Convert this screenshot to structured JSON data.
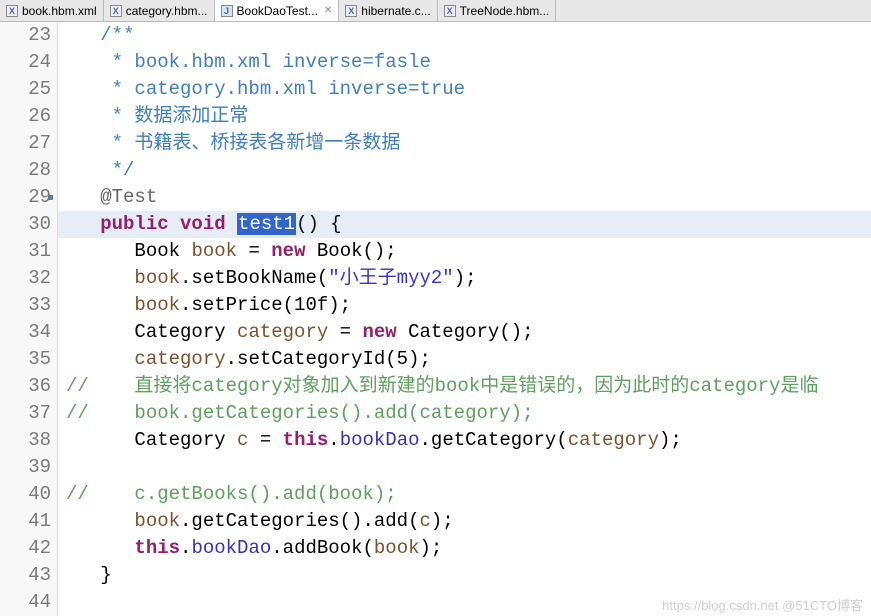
{
  "tabs": [
    {
      "label": "book.hbm.xml",
      "icon": "x",
      "active": false
    },
    {
      "label": "category.hbm...",
      "icon": "x",
      "active": false
    },
    {
      "label": "BookDaoTest...",
      "icon": "j",
      "active": true
    },
    {
      "label": "hibernate.c...",
      "icon": "x",
      "active": false
    },
    {
      "label": "TreeNode.hbm...",
      "icon": "x",
      "active": false
    }
  ],
  "lines": {
    "start": 23,
    "highlighted": 30,
    "marker_at": 29,
    "items": [
      {
        "n": 23,
        "kind": "doc",
        "text": "   /**"
      },
      {
        "n": 24,
        "kind": "doc",
        "text": "    * book.hbm.xml inverse=fasle"
      },
      {
        "n": 25,
        "kind": "doc",
        "text": "    * category.hbm.xml inverse=true"
      },
      {
        "n": 26,
        "kind": "doc",
        "text": "    * 数据添加正常"
      },
      {
        "n": 27,
        "kind": "doc",
        "text": "    * 书籍表、桥接表各新增一条数据"
      },
      {
        "n": 28,
        "kind": "doc",
        "text": "    */"
      },
      {
        "n": 29,
        "kind": "anno",
        "text": "   @Test"
      },
      {
        "n": 30,
        "kind": "sig",
        "pre": "   ",
        "kw": "public void ",
        "sel": "test1",
        "post": "() {"
      },
      {
        "n": 31,
        "kind": "stmt",
        "pre": "      ",
        "segs": [
          {
            "t": "Book ",
            "c": "c-type"
          },
          {
            "t": "book",
            "c": "c-var"
          },
          {
            "t": " = ",
            "c": ""
          },
          {
            "t": "new",
            "c": "c-kw"
          },
          {
            "t": " Book();",
            "c": ""
          }
        ]
      },
      {
        "n": 32,
        "kind": "stmt",
        "pre": "      ",
        "segs": [
          {
            "t": "book",
            "c": "c-var"
          },
          {
            "t": ".setBookName(",
            "c": ""
          },
          {
            "t": "\"小王子myy2\"",
            "c": "c-str"
          },
          {
            "t": ");",
            "c": ""
          }
        ]
      },
      {
        "n": 33,
        "kind": "stmt",
        "pre": "      ",
        "segs": [
          {
            "t": "book",
            "c": "c-var"
          },
          {
            "t": ".setPrice(10f);",
            "c": ""
          }
        ]
      },
      {
        "n": 34,
        "kind": "stmt",
        "pre": "      ",
        "segs": [
          {
            "t": "Category ",
            "c": "c-type"
          },
          {
            "t": "category",
            "c": "c-var"
          },
          {
            "t": " = ",
            "c": ""
          },
          {
            "t": "new",
            "c": "c-kw"
          },
          {
            "t": " Category();",
            "c": ""
          }
        ]
      },
      {
        "n": 35,
        "kind": "stmt",
        "pre": "      ",
        "segs": [
          {
            "t": "category",
            "c": "c-var"
          },
          {
            "t": ".setCategoryId(5);",
            "c": ""
          }
        ]
      },
      {
        "n": 36,
        "kind": "lcomment",
        "text": "//    直接将category对象加入到新建的book中是错误的，因为此时的category是临"
      },
      {
        "n": 37,
        "kind": "lcomment",
        "text": "//    book.getCategories().add(category);"
      },
      {
        "n": 38,
        "kind": "stmt",
        "pre": "      ",
        "segs": [
          {
            "t": "Category ",
            "c": "c-type"
          },
          {
            "t": "c",
            "c": "c-var"
          },
          {
            "t": " = ",
            "c": ""
          },
          {
            "t": "this",
            "c": "c-kw"
          },
          {
            "t": ".",
            "c": ""
          },
          {
            "t": "bookDao",
            "c": "c-field"
          },
          {
            "t": ".getCategory(",
            "c": ""
          },
          {
            "t": "category",
            "c": "c-var"
          },
          {
            "t": ");",
            "c": ""
          }
        ]
      },
      {
        "n": 39,
        "kind": "blank",
        "text": ""
      },
      {
        "n": 40,
        "kind": "lcomment",
        "text": "//    c.getBooks().add(book);"
      },
      {
        "n": 41,
        "kind": "stmt",
        "pre": "      ",
        "segs": [
          {
            "t": "book",
            "c": "c-var"
          },
          {
            "t": ".getCategories().add(",
            "c": ""
          },
          {
            "t": "c",
            "c": "c-var"
          },
          {
            "t": ");",
            "c": ""
          }
        ]
      },
      {
        "n": 42,
        "kind": "stmt",
        "pre": "      ",
        "segs": [
          {
            "t": "this",
            "c": "c-kw"
          },
          {
            "t": ".",
            "c": ""
          },
          {
            "t": "bookDao",
            "c": "c-field"
          },
          {
            "t": ".addBook(",
            "c": ""
          },
          {
            "t": "book",
            "c": "c-var"
          },
          {
            "t": ");",
            "c": ""
          }
        ]
      },
      {
        "n": 43,
        "kind": "plain",
        "text": "   }"
      },
      {
        "n": 44,
        "kind": "blank",
        "text": ""
      }
    ]
  },
  "watermark": "https://blog.csdn.net @51CTO博客"
}
